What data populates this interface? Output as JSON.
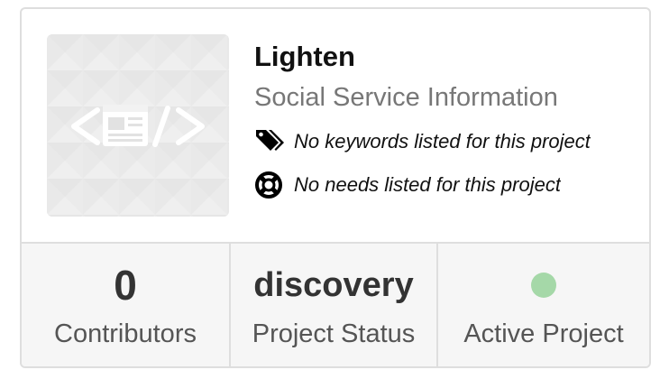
{
  "project": {
    "title": "Lighten",
    "subtitle": "Social Service Information",
    "keywords_text": "No keywords listed for this project",
    "needs_text": "No needs listed for this project",
    "thumbnail_icon": "code-document-icon"
  },
  "stats": {
    "contributors": {
      "value": "0",
      "label": "Contributors"
    },
    "status": {
      "value": "discovery",
      "label": "Project Status"
    },
    "active": {
      "label": "Active Project",
      "indicator_color": "#a5d8a8"
    }
  },
  "colors": {
    "border": "#dedede",
    "stats_bg": "#f6f6f6",
    "subtitle": "#777777"
  }
}
